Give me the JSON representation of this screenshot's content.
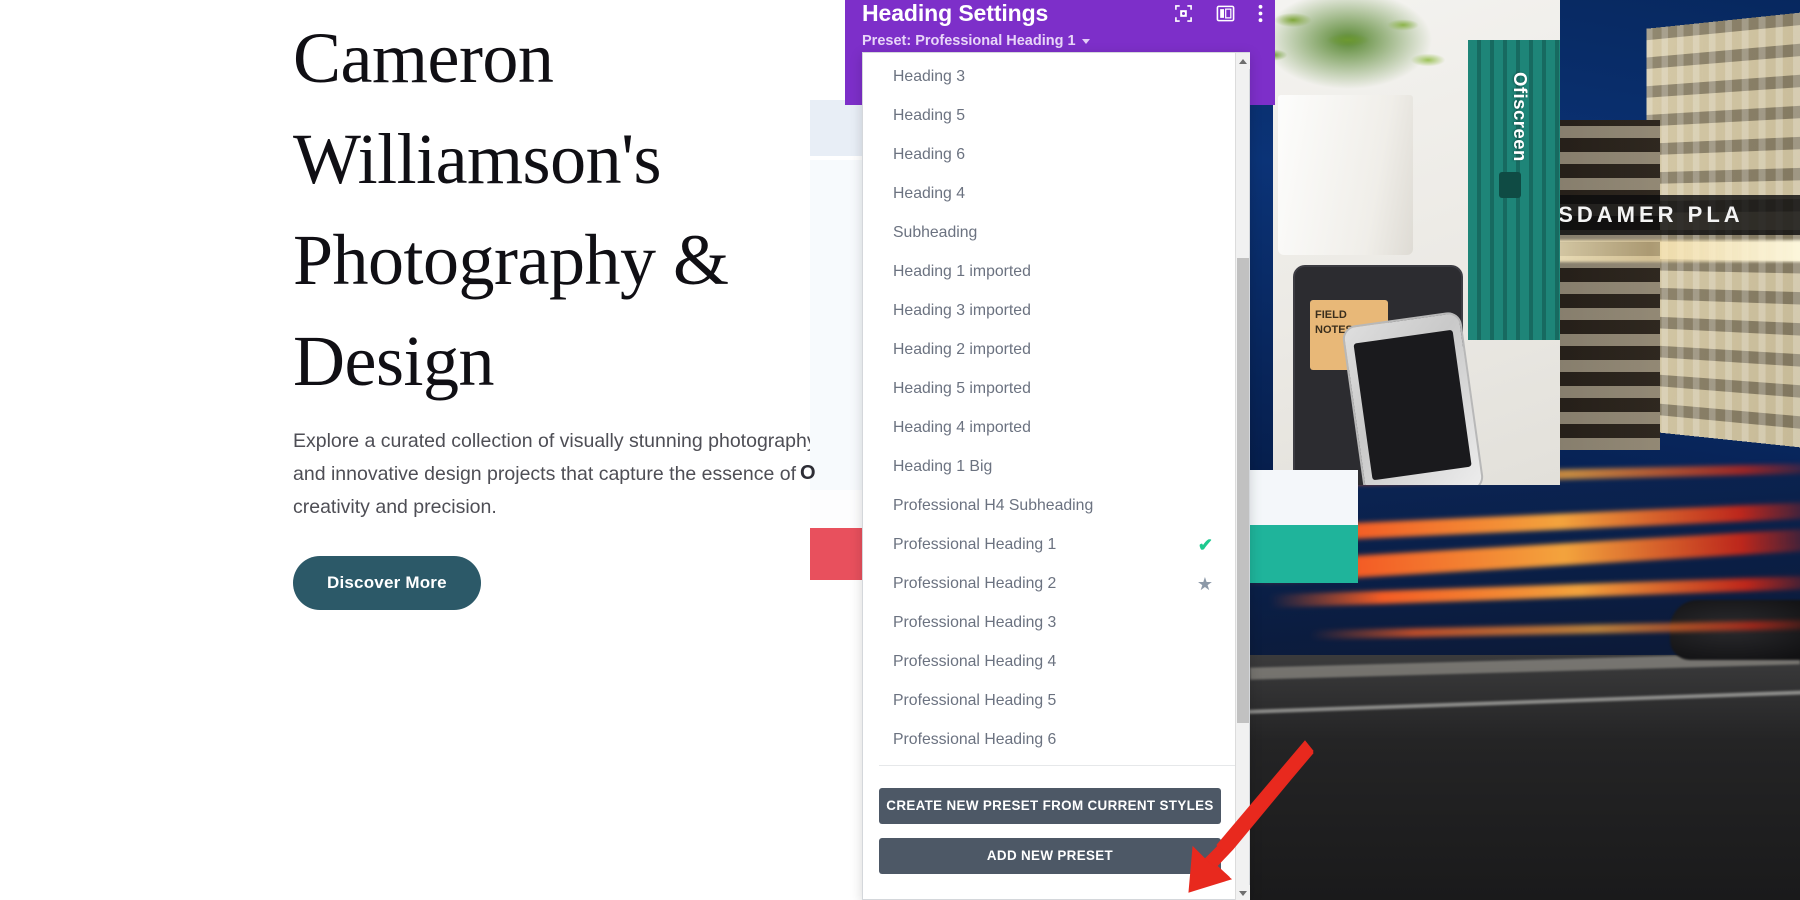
{
  "website": {
    "heading": "Cameron Williamson's Photography & Design",
    "paragraph": "Explore a curated collection of visually stunning photography and innovative design projects that capture the essence of creativity and precision.",
    "cta_label": "Discover More",
    "cta_color": "#2c5968",
    "card_letter": "O"
  },
  "imagery": {
    "desk_photo_label": "Ofiscreen",
    "notebook_tag_text": "FIELD NOTES",
    "city_sign_text": "POTSDAMER PLA"
  },
  "editor": {
    "title": "Heading Settings",
    "preset_row_label": "Preset: Professional Heading 1",
    "accent_color": "#7d2fc9",
    "icons": [
      {
        "name": "focus-target-icon"
      },
      {
        "name": "layout-panel-icon"
      },
      {
        "name": "more-vertical-icon"
      }
    ],
    "dropdown": {
      "items": [
        {
          "label": "Heading 3",
          "mark": ""
        },
        {
          "label": "Heading 5",
          "mark": ""
        },
        {
          "label": "Heading 6",
          "mark": ""
        },
        {
          "label": "Heading 4",
          "mark": ""
        },
        {
          "label": "Subheading",
          "mark": ""
        },
        {
          "label": "Heading 1 imported",
          "mark": ""
        },
        {
          "label": "Heading 3 imported",
          "mark": ""
        },
        {
          "label": "Heading 2 imported",
          "mark": ""
        },
        {
          "label": "Heading 5 imported",
          "mark": ""
        },
        {
          "label": "Heading 4 imported",
          "mark": ""
        },
        {
          "label": "Heading 1 Big",
          "mark": ""
        },
        {
          "label": "Professional H4 Subheading",
          "mark": ""
        },
        {
          "label": "Professional Heading 1",
          "mark": "check"
        },
        {
          "label": "Professional Heading 2",
          "mark": "star"
        },
        {
          "label": "Professional Heading 3",
          "mark": ""
        },
        {
          "label": "Professional Heading 4",
          "mark": ""
        },
        {
          "label": "Professional Heading 5",
          "mark": ""
        },
        {
          "label": "Professional Heading 6",
          "mark": ""
        }
      ],
      "selected": "Professional Heading 1",
      "default_preset": "Professional Heading 2",
      "check_color": "#1ec98f",
      "star_color": "#8c99a8",
      "create_button_label": "Create New Preset From Current Styles",
      "add_button_label": "Add New Preset",
      "button_color": "#4d5866"
    }
  },
  "annotation": {
    "arrow_color": "#e8291e",
    "points_to": "Add New Preset"
  }
}
